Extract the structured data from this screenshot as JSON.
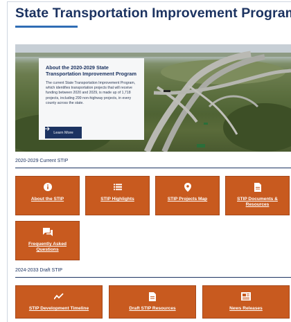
{
  "page": {
    "title": "State Transportation Improvement Program"
  },
  "hero": {
    "card_title": "About the 2020-2029 State Transportation Improvement Program",
    "card_body": "The current State Transportation Improvement Program, which identifies transportation projects that will receive funding between 2020 and 2029, is made up of 1,718 projects, including 299 non-highway projects, in every county across the state.",
    "button_label": "Learn More",
    "button_icon": "arrow-right-icon"
  },
  "current_stip": {
    "heading": "2020-2029 Current STIP",
    "tiles": [
      {
        "label": "About the STIP",
        "icon": "info-icon"
      },
      {
        "label": "STIP Highlights",
        "icon": "list-icon"
      },
      {
        "label": "STIP Projects Map",
        "icon": "map-pin-icon"
      },
      {
        "label": "STIP Documents & Resources",
        "icon": "document-icon"
      },
      {
        "label": "Frequently Asked Questions",
        "icon": "chat-icon"
      }
    ]
  },
  "draft_stip": {
    "heading": "2024-2033 Draft STIP",
    "tiles": [
      {
        "label": "STIP Development Timeline",
        "icon": "trend-line-icon"
      },
      {
        "label": "Draft STIP Resources",
        "icon": "document-icon"
      },
      {
        "label": "News Releases",
        "icon": "newspaper-icon"
      }
    ]
  },
  "colors": {
    "navy": "#1c3361",
    "accent_blue": "#2f6db5",
    "tile_orange": "#c85a1f"
  }
}
